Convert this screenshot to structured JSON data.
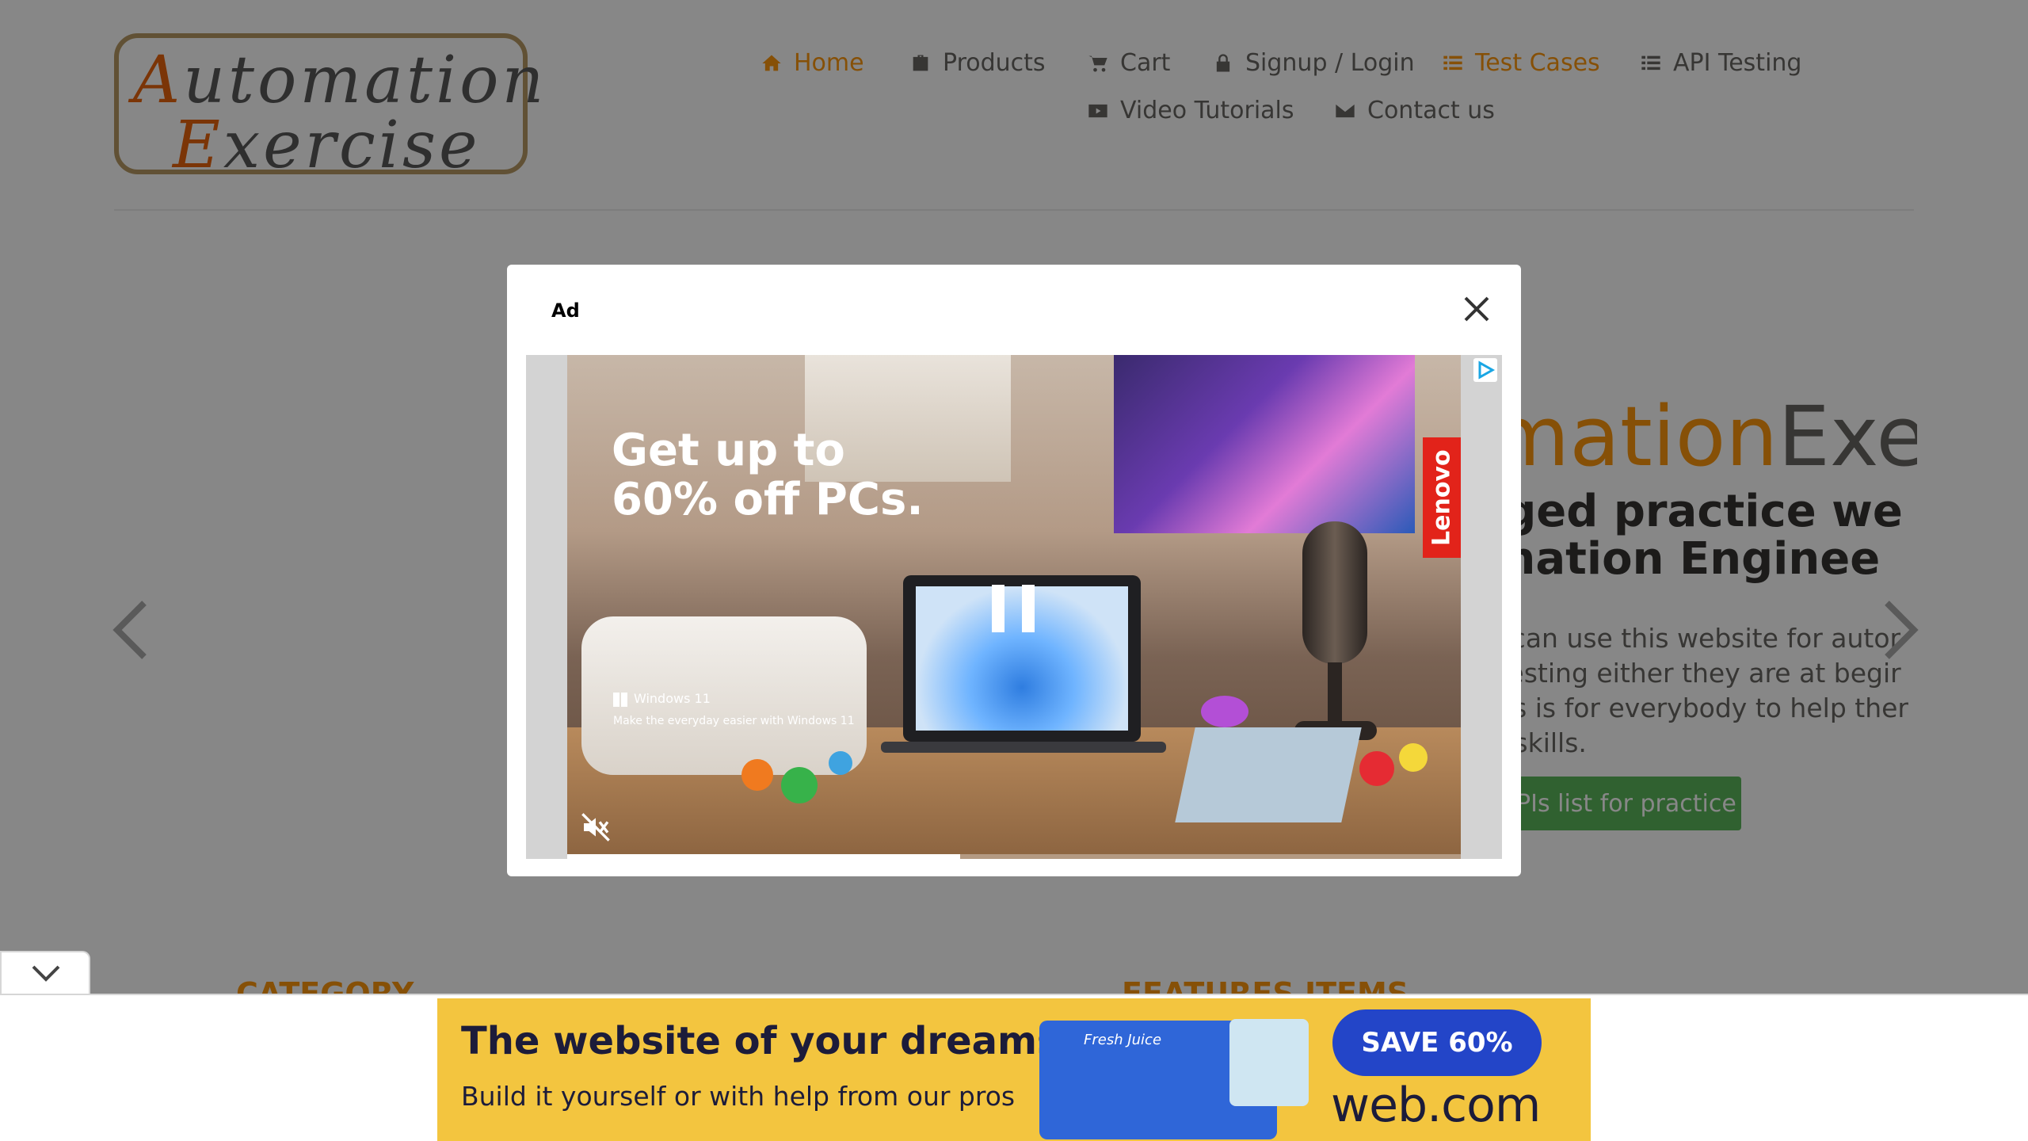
{
  "logo": {
    "line1_cap": "A",
    "line1_rest": "utomation",
    "line2_cap": "E",
    "line2_rest": "xercise"
  },
  "nav": {
    "items": [
      {
        "label": "Home",
        "icon": "home-icon"
      },
      {
        "label": "Products",
        "icon": "briefcase-icon"
      },
      {
        "label": "Cart",
        "icon": "cart-icon"
      },
      {
        "label": "Signup / Login",
        "icon": "lock-icon"
      },
      {
        "label": "Test Cases",
        "icon": "list-icon"
      },
      {
        "label": "API Testing",
        "icon": "list-icon"
      },
      {
        "label": "Video Tutorials",
        "icon": "youtube-icon"
      },
      {
        "label": "Contact us",
        "icon": "envelope-icon"
      }
    ]
  },
  "hero": {
    "title_orange": "mation",
    "title_gray": "Exer",
    "subtitle_line1": "lged practice we",
    "subtitle_line2": "mation Enginee",
    "para_lines": [
      "s can use this website for autor",
      " testing either they are at begir",
      "his is for everybody to help ther",
      "n skills."
    ],
    "button_label": "PIs list for practice"
  },
  "sections": {
    "category": "CATEGORY",
    "features": "FEATURES ITEMS"
  },
  "modal": {
    "label": "Ad",
    "video": {
      "headline_line1": "Get up to",
      "headline_line2": "60% off PCs.",
      "brand": "Lenovo",
      "windows_label": "Windows 11",
      "windows_sub": "Make the everyday easier with Windows 11",
      "progress": 0.44,
      "icons": [
        "pause-icon",
        "mute-icon",
        "adchoices-icon",
        "close-icon"
      ]
    }
  },
  "banner_ad": {
    "headline": "The website of your dreams",
    "subline": "Build it yourself or with help from our pros",
    "mock_label": "Fresh Juice",
    "cta": "SAVE 60%",
    "brand": "web.com"
  },
  "colors": {
    "accent": "#fe980f",
    "button_green": "#5cb85c",
    "overlay": "rgba(0,0,0,0.47)",
    "banner_bg": "#f3c53f",
    "cta_blue": "#2345c8"
  }
}
